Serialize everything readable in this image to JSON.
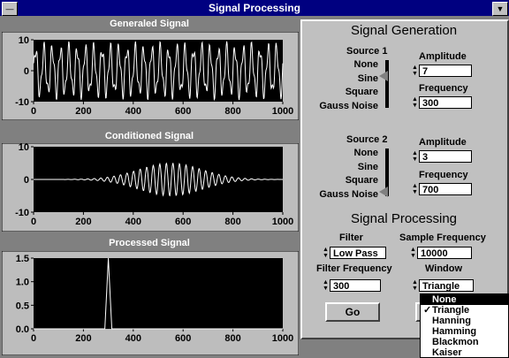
{
  "window": {
    "title": "Signal Processing"
  },
  "titlebar": {
    "menu_glyph": "—",
    "min_glyph": "▼"
  },
  "panels": {
    "generated": {
      "title": "Generaled Signal"
    },
    "conditioned": {
      "title": "Conditioned Signal"
    },
    "processed": {
      "title": "Processed Signal"
    }
  },
  "chart_data": [
    {
      "type": "line",
      "title": "Generaled Signal",
      "x": {
        "ticks": [
          0,
          200,
          400,
          600,
          800,
          1000
        ],
        "range": [
          0,
          1000
        ]
      },
      "y": {
        "ticks": [
          10,
          0,
          -10
        ],
        "range": [
          -10,
          10
        ]
      },
      "series": [
        {
          "description": "dense oscillation, amplitude ~9, spans full x range"
        }
      ]
    },
    {
      "type": "line",
      "title": "Conditioned Signal",
      "x": {
        "ticks": [
          0,
          200,
          400,
          600,
          800,
          1000
        ],
        "range": [
          0,
          1000
        ]
      },
      "y": {
        "ticks": [
          10,
          0,
          -10
        ],
        "range": [
          -10,
          10
        ]
      },
      "series": [
        {
          "description": "oscillation with envelope peaking ~5 near x=550"
        }
      ]
    },
    {
      "type": "line",
      "title": "Processed Signal",
      "x": {
        "ticks": [
          0,
          200,
          400,
          600,
          800,
          1000
        ],
        "range": [
          0,
          1000
        ]
      },
      "y": {
        "ticks": [
          1.5,
          1.0,
          0.5,
          0.0
        ],
        "range": [
          0,
          1.5
        ]
      },
      "series": [
        {
          "peak_x": 300,
          "peak_y": 1.5
        }
      ]
    }
  ],
  "gen": {
    "title": "Signal Generation",
    "source1": {
      "label": "Source 1",
      "options": [
        "None",
        "Sine",
        "Square",
        "Gauss Noise"
      ],
      "selected": "Sine",
      "amp_label": "Amplitude",
      "amp_value": "7",
      "freq_label": "Frequency",
      "freq_value": "300"
    },
    "source2": {
      "label": "Source 2",
      "options": [
        "None",
        "Sine",
        "Square",
        "Gauss Noise"
      ],
      "selected": "Gauss Noise",
      "amp_label": "Amplitude",
      "amp_value": "3",
      "freq_label": "Frequency",
      "freq_value": "700"
    }
  },
  "proc": {
    "title": "Signal Processing",
    "filter_label": "Filter",
    "filter_value": "Low Pass",
    "sample_label": "Sample Frequency",
    "sample_value": "10000",
    "ffreq_label": "Filter Frequency",
    "ffreq_value": "300",
    "window_label": "Window",
    "window_value": "Triangle",
    "go_label": "Go"
  },
  "window_menu": {
    "items": [
      "None",
      "Triangle",
      "Hanning",
      "Hamming",
      "Blackmon",
      "Kaiser"
    ],
    "highlighted": "None",
    "checked": "Triangle"
  }
}
